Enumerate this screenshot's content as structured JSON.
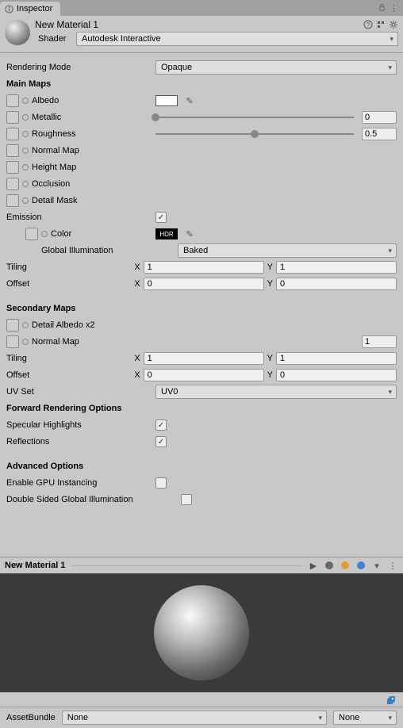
{
  "tab": {
    "title": "Inspector"
  },
  "header": {
    "material_name": "New Material 1",
    "shader_label": "Shader",
    "shader_value": "Autodesk Interactive"
  },
  "rendering_mode": {
    "label": "Rendering Mode",
    "value": "Opaque"
  },
  "main_maps": {
    "heading": "Main Maps",
    "albedo": "Albedo",
    "metallic": "Metallic",
    "metallic_value": "0",
    "roughness": "Roughness",
    "roughness_value": "0.5",
    "normal_map": "Normal Map",
    "height_map": "Height Map",
    "occlusion": "Occlusion",
    "detail_mask": "Detail Mask"
  },
  "emission": {
    "label": "Emission",
    "color": "Color",
    "hdr": "HDR",
    "gi_label": "Global Illumination",
    "gi_value": "Baked"
  },
  "tiling": {
    "label": "Tiling",
    "x": "1",
    "y": "1"
  },
  "offset": {
    "label": "Offset",
    "x": "0",
    "y": "0"
  },
  "secondary": {
    "heading": "Secondary Maps",
    "detail_albedo": "Detail Albedo x2",
    "normal_map": "Normal Map",
    "normal_value": "1",
    "tiling": {
      "label": "Tiling",
      "x": "1",
      "y": "1"
    },
    "offset": {
      "label": "Offset",
      "x": "0",
      "y": "0"
    },
    "uv_set": {
      "label": "UV Set",
      "value": "UV0"
    }
  },
  "forward": {
    "heading": "Forward Rendering Options",
    "specular": "Specular Highlights",
    "reflections": "Reflections"
  },
  "advanced": {
    "heading": "Advanced Options",
    "gpu": "Enable GPU Instancing",
    "dsgi": "Double Sided Global Illumination"
  },
  "preview": {
    "title": "New Material 1"
  },
  "footer": {
    "label": "AssetBundle",
    "bundle_value": "None",
    "variant_value": "None"
  },
  "xy_labels": {
    "x": "X",
    "y": "Y"
  }
}
